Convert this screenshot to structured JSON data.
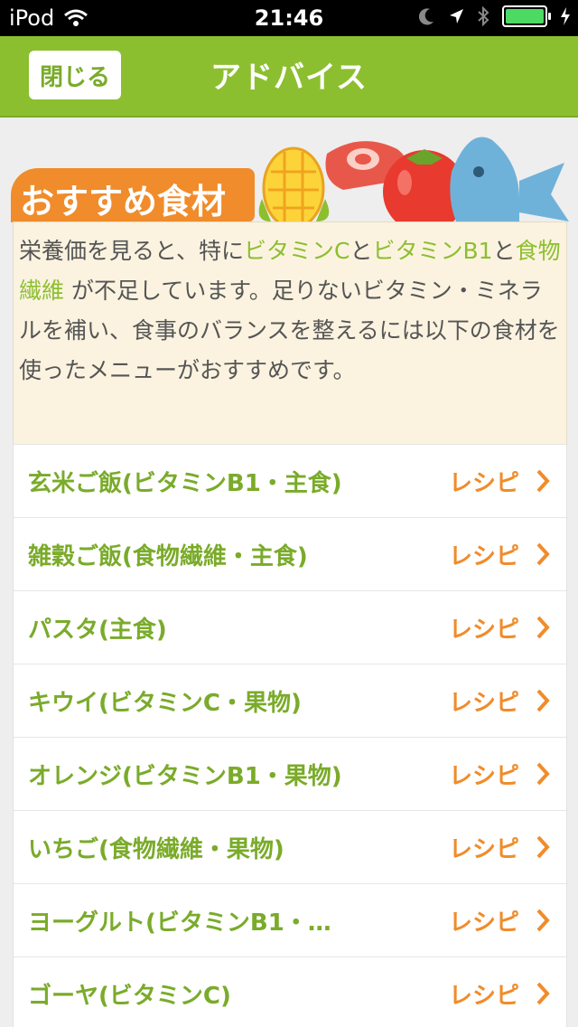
{
  "status_bar": {
    "carrier": "iPod",
    "time": "21:46",
    "icons": [
      "wifi-icon",
      "moon-icon",
      "location-icon",
      "bluetooth-icon",
      "battery-icon",
      "charging-icon"
    ]
  },
  "nav": {
    "close_label": "閉じる",
    "title": "アドバイス"
  },
  "section": {
    "badge": "おすすめ食材",
    "illustration_items": [
      "corn",
      "meat",
      "tomato",
      "fish"
    ]
  },
  "advice": {
    "t1": "栄養価を見ると、特に",
    "k1": "ビタミンC",
    "t2": "と",
    "k2": "ビタミンB1",
    "t3": "と",
    "k3": "食物繊維",
    "t4": " が不足しています。足りないビタミン・ミネラルを補い、食事のバランスを整えるには以下の食材を使ったメニューがおすすめです。"
  },
  "foods": [
    {
      "name": "玄米ご飯(ビタミンB1・主食)",
      "link": "レシピ"
    },
    {
      "name": "雑穀ご飯(食物繊維・主食)",
      "link": "レシピ"
    },
    {
      "name": "パスタ(主食)",
      "link": "レシピ"
    },
    {
      "name": "キウイ(ビタミンC・果物)",
      "link": "レシピ"
    },
    {
      "name": "オレンジ(ビタミンB1・果物)",
      "link": "レシピ"
    },
    {
      "name": "いちご(食物繊維・果物)",
      "link": "レシピ"
    },
    {
      "name": "ヨーグルト(ビタミンB1・…",
      "link": "レシピ"
    },
    {
      "name": "ゴーヤ(ビタミンC)",
      "link": "レシピ"
    }
  ],
  "colors": {
    "nav_green": "#8cbf2f",
    "text_green": "#7aab2a",
    "accent_orange": "#f08c2b",
    "advice_bg": "#fbf3e0"
  }
}
